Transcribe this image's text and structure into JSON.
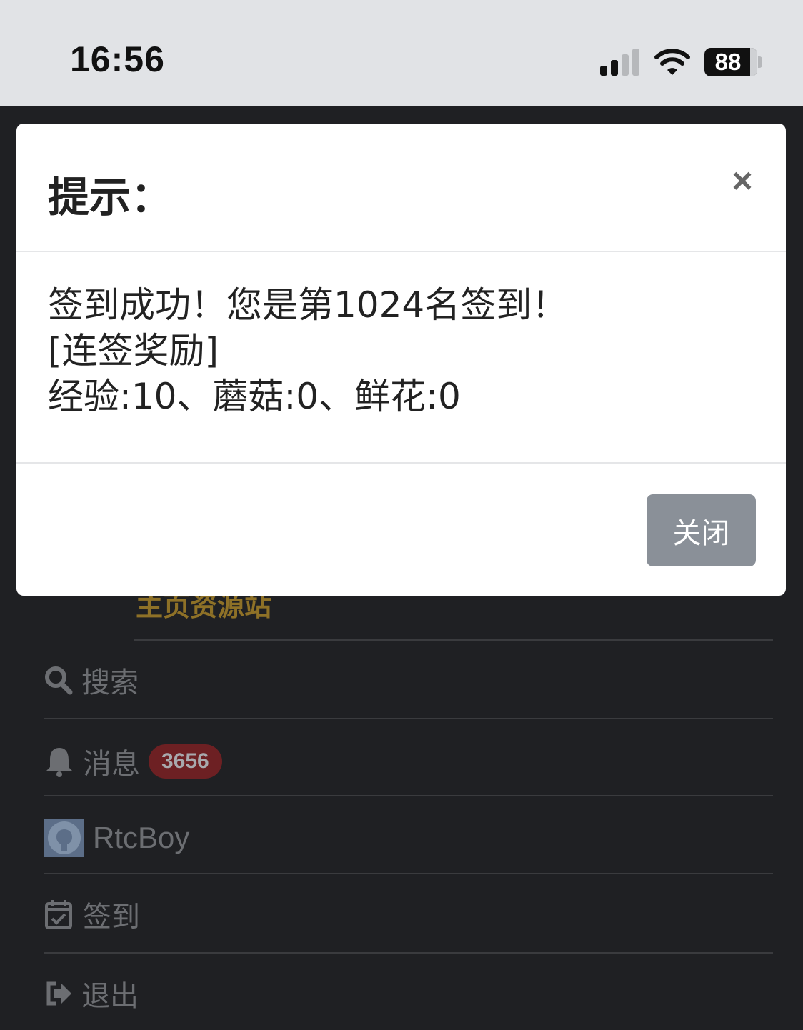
{
  "status_bar": {
    "time": "16:56",
    "battery": "88",
    "icons": [
      "cellular-signal-icon",
      "wifi-icon",
      "battery-icon"
    ]
  },
  "menu": {
    "partial_link": "主页资源站",
    "search_label": "搜索",
    "messages_label": "消息",
    "messages_count": "3656",
    "user_name": "RtcBoy",
    "checkin_label": "签到",
    "logout_label": "退出"
  },
  "modal": {
    "title": "提示：",
    "close_symbol": "×",
    "body_line1": "签到成功！您是第1024名签到！",
    "body_line2": "[连签奖励]",
    "body_line3": "经验:10、蘑菇:0、鲜花:0",
    "close_button": "关闭"
  },
  "colors": {
    "background": "#1f2023",
    "gold_link": "#8e7127",
    "badge": "#6d2023",
    "button": "#8a9098"
  }
}
